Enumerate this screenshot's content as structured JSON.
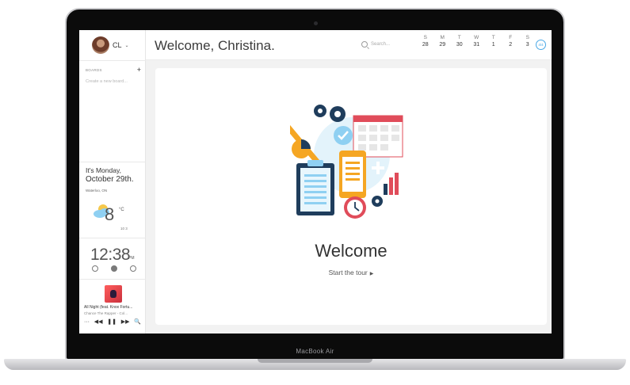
{
  "device": {
    "brand": "MacBook Air"
  },
  "profile": {
    "initials": "CL",
    "caret": "⌄"
  },
  "sidebar": {
    "boards_header": "BOARDS",
    "add_symbol": "+",
    "create_board": "Create a new board...",
    "date_line1": "It's Monday,",
    "date_line2": "October 29th.",
    "location": "Waterloo, ON",
    "temperature": "8",
    "temperature_unit": "°C",
    "forecast": "10 3",
    "time": "12:38",
    "ampm": "PM",
    "song": "All Night (feat. Knox Fortu...",
    "artist": "Chance The Rapper - Col...",
    "player_controls": [
      "···",
      "◀◀",
      "❚❚",
      "▶▶",
      "🔍"
    ]
  },
  "header": {
    "greeting": "Welcome, Christina.",
    "search_placeholder": "Search...",
    "week_button": "4/4",
    "week": [
      {
        "day": "S",
        "date": "28"
      },
      {
        "day": "M",
        "date": "29"
      },
      {
        "day": "T",
        "date": "30"
      },
      {
        "day": "W",
        "date": "31"
      },
      {
        "day": "T",
        "date": "1"
      },
      {
        "day": "F",
        "date": "2"
      },
      {
        "day": "S",
        "date": "3"
      }
    ]
  },
  "main": {
    "title": "Welcome",
    "tour_label": "Start the tour",
    "tour_arrow": "▶"
  },
  "colors": {
    "accent_blue": "#4aa8e6",
    "illustration_navy": "#1f3d5c",
    "illustration_red": "#e04c5a",
    "illustration_orange": "#f5a623",
    "illustration_light_blue": "#8fd0f2"
  }
}
